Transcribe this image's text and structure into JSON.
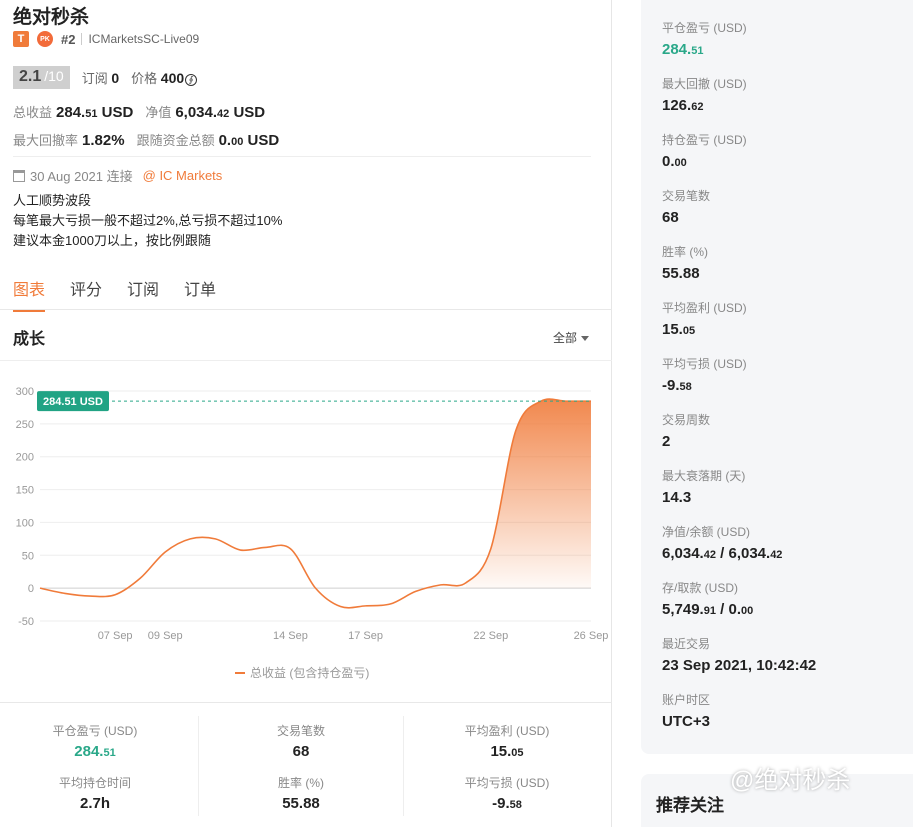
{
  "header": {
    "title": "绝对秒杀",
    "badge_t": "T",
    "badge_pk": "PK",
    "rank": "#2",
    "account": "ICMarketsSC-Live09"
  },
  "score": {
    "value": "2.1",
    "total": "/10",
    "subs_label": "订阅",
    "subs_value": "0",
    "price_label": "价格",
    "price_value": "400",
    "coin_symbol": "∮"
  },
  "stats": {
    "total_profit_label": "总收益",
    "total_profit_int": "284.",
    "total_profit_dec": "51",
    "total_profit_unit": "USD",
    "equity_label": "净值",
    "equity_int": "6,034.",
    "equity_dec": "42",
    "equity_unit": "USD",
    "max_dd_label": "最大回撤率",
    "max_dd_value": "1.82%",
    "follow_label": "跟随资金总额",
    "follow_int": "0.",
    "follow_dec": "00",
    "follow_unit": "USD"
  },
  "connect": {
    "date": "30 Aug 2021 连接",
    "broker": "@ IC Markets"
  },
  "description": [
    "人工顺势波段",
    "每笔最大亏损一般不超过2%,总亏损不超过10%",
    "建议本金1000刀以上，按比例跟随"
  ],
  "tabs": [
    "图表",
    "评分",
    "订阅",
    "订单"
  ],
  "chart_section": {
    "title": "成长",
    "range": "全部"
  },
  "chart_data": {
    "type": "area",
    "x": [
      "2021-09-04",
      "2021-09-05",
      "2021-09-06",
      "2021-09-07",
      "2021-09-08",
      "2021-09-09",
      "2021-09-10",
      "2021-09-11",
      "2021-09-12",
      "2021-09-13",
      "2021-09-14",
      "2021-09-15",
      "2021-09-16",
      "2021-09-17",
      "2021-09-18",
      "2021-09-19",
      "2021-09-20",
      "2021-09-21",
      "2021-09-22",
      "2021-09-23",
      "2021-09-24",
      "2021-09-25",
      "2021-09-26"
    ],
    "x_ticks": [
      "07 Sep",
      "09 Sep",
      "14 Sep",
      "17 Sep",
      "22 Sep",
      "26 Sep"
    ],
    "series": [
      {
        "name": "总收益 (包含持仓盈亏)",
        "values": [
          0,
          -8,
          -12,
          -10,
          15,
          55,
          75,
          75,
          58,
          62,
          60,
          0,
          -28,
          -27,
          -24,
          -5,
          5,
          8,
          60,
          240,
          284.51,
          284.51,
          284.51
        ],
        "color": "#f07b3a"
      }
    ],
    "yticks": [
      300,
      250,
      200,
      150,
      100,
      50,
      0,
      -50
    ],
    "ylim": [
      -50,
      300
    ],
    "marker_label": "284.51 USD",
    "marker_value": 284.51,
    "grid": true,
    "legend_position": "bottom"
  },
  "bottom_stats": [
    {
      "label": "平仓盈亏 (USD)",
      "int": "284.",
      "dec": "51",
      "green": true
    },
    {
      "label": "交易笔数",
      "int": "68",
      "dec": ""
    },
    {
      "label": "平均盈利 (USD)",
      "int": "15.",
      "dec": "05"
    },
    {
      "label": "平均持仓时间",
      "int": "2.7h",
      "dec": ""
    },
    {
      "label": "胜率 (%)",
      "int": "55.88",
      "dec": ""
    },
    {
      "label": "平均亏损 (USD)",
      "int": "-9.",
      "dec": "58"
    }
  ],
  "panel": [
    {
      "label": "平仓盈亏 (USD)",
      "int": "284.",
      "dec": "51",
      "green": true
    },
    {
      "label": "最大回撤 (USD)",
      "int": "126.",
      "dec": "62"
    },
    {
      "label": "持仓盈亏 (USD)",
      "int": "0.",
      "dec": "00"
    },
    {
      "label": "交易笔数",
      "int": "68",
      "dec": ""
    },
    {
      "label": "胜率 (%)",
      "int": "55.88",
      "dec": ""
    },
    {
      "label": "平均盈利 (USD)",
      "int": "15.",
      "dec": "05"
    },
    {
      "label": "平均亏损 (USD)",
      "int": "-9.",
      "dec": "58"
    },
    {
      "label": "交易周数",
      "int": "2",
      "dec": ""
    },
    {
      "label": "最大衰落期 (天)",
      "int": "14.3",
      "dec": ""
    },
    {
      "label": "净值/余额 (USD)",
      "int": "6,034.",
      "dec": "42",
      "int2": " / 6,034.",
      "dec2": "42"
    },
    {
      "label": "存/取款 (USD)",
      "int": "5,749.",
      "dec": "91",
      "int2": " / 0.",
      "dec2": "00"
    },
    {
      "label": "最近交易",
      "int": "23 Sep 2021, 10:42:42",
      "dec": ""
    },
    {
      "label": "账户时区",
      "int": "UTC+3",
      "dec": ""
    }
  ],
  "panel2": {
    "title": "推荐关注"
  },
  "watermark": "@绝对秒杀",
  "colors": {
    "accent": "#f07b3a",
    "green": "#2aa889",
    "panel_bg": "#f5f6f8"
  }
}
